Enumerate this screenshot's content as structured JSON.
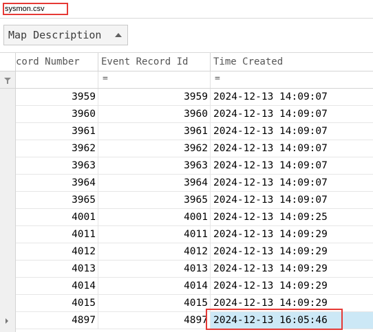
{
  "tab": {
    "file_name": "sysmon.csv"
  },
  "grouping": {
    "label": "Map Description"
  },
  "columns": [
    "cord Number",
    "Event Record Id",
    "Time Created"
  ],
  "filter_ops": [
    "=",
    "="
  ],
  "rows": [
    {
      "record_number": "3959",
      "event_record_id": "3959",
      "time_created": "2024-12-13 14:09:07"
    },
    {
      "record_number": "3960",
      "event_record_id": "3960",
      "time_created": "2024-12-13 14:09:07"
    },
    {
      "record_number": "3961",
      "event_record_id": "3961",
      "time_created": "2024-12-13 14:09:07"
    },
    {
      "record_number": "3962",
      "event_record_id": "3962",
      "time_created": "2024-12-13 14:09:07"
    },
    {
      "record_number": "3963",
      "event_record_id": "3963",
      "time_created": "2024-12-13 14:09:07"
    },
    {
      "record_number": "3964",
      "event_record_id": "3964",
      "time_created": "2024-12-13 14:09:07"
    },
    {
      "record_number": "3965",
      "event_record_id": "3965",
      "time_created": "2024-12-13 14:09:07"
    },
    {
      "record_number": "4001",
      "event_record_id": "4001",
      "time_created": "2024-12-13 14:09:25"
    },
    {
      "record_number": "4011",
      "event_record_id": "4011",
      "time_created": "2024-12-13 14:09:29"
    },
    {
      "record_number": "4012",
      "event_record_id": "4012",
      "time_created": "2024-12-13 14:09:29"
    },
    {
      "record_number": "4013",
      "event_record_id": "4013",
      "time_created": "2024-12-13 14:09:29"
    },
    {
      "record_number": "4014",
      "event_record_id": "4014",
      "time_created": "2024-12-13 14:09:29"
    },
    {
      "record_number": "4015",
      "event_record_id": "4015",
      "time_created": "2024-12-13 14:09:29"
    },
    {
      "record_number": "4897",
      "event_record_id": "4897",
      "time_created": "2024-12-13 16:05:46"
    }
  ],
  "selected_row_index": 13,
  "colors": {
    "highlight_border": "#e53935",
    "selected_cell": "#cce8f6"
  }
}
